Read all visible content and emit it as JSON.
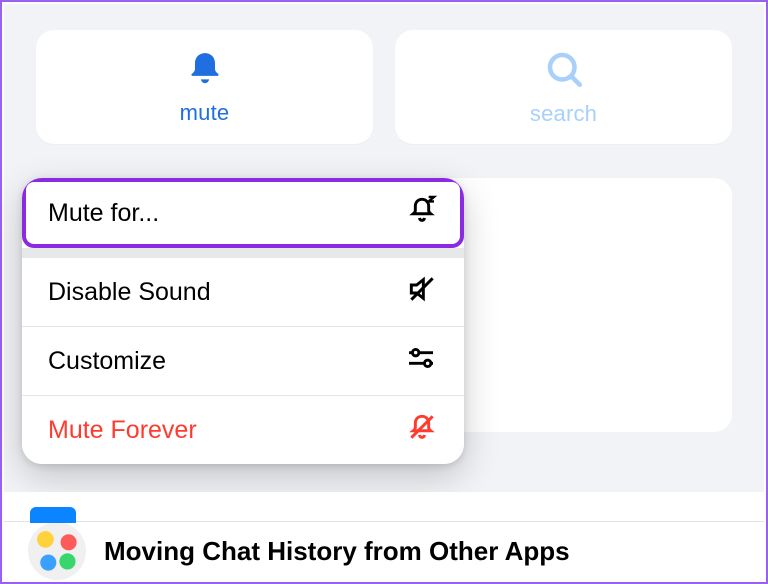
{
  "actions": {
    "mute": {
      "label": "mute"
    },
    "search": {
      "label": "search"
    }
  },
  "popup": {
    "items": {
      "mute_for": {
        "label": "Mute for..."
      },
      "disable_sound": {
        "label": "Disable Sound"
      },
      "customize": {
        "label": "Customize"
      },
      "mute_forever": {
        "label": "Mute Forever"
      }
    }
  },
  "chat": {
    "title": "Moving Chat History from Other Apps"
  }
}
